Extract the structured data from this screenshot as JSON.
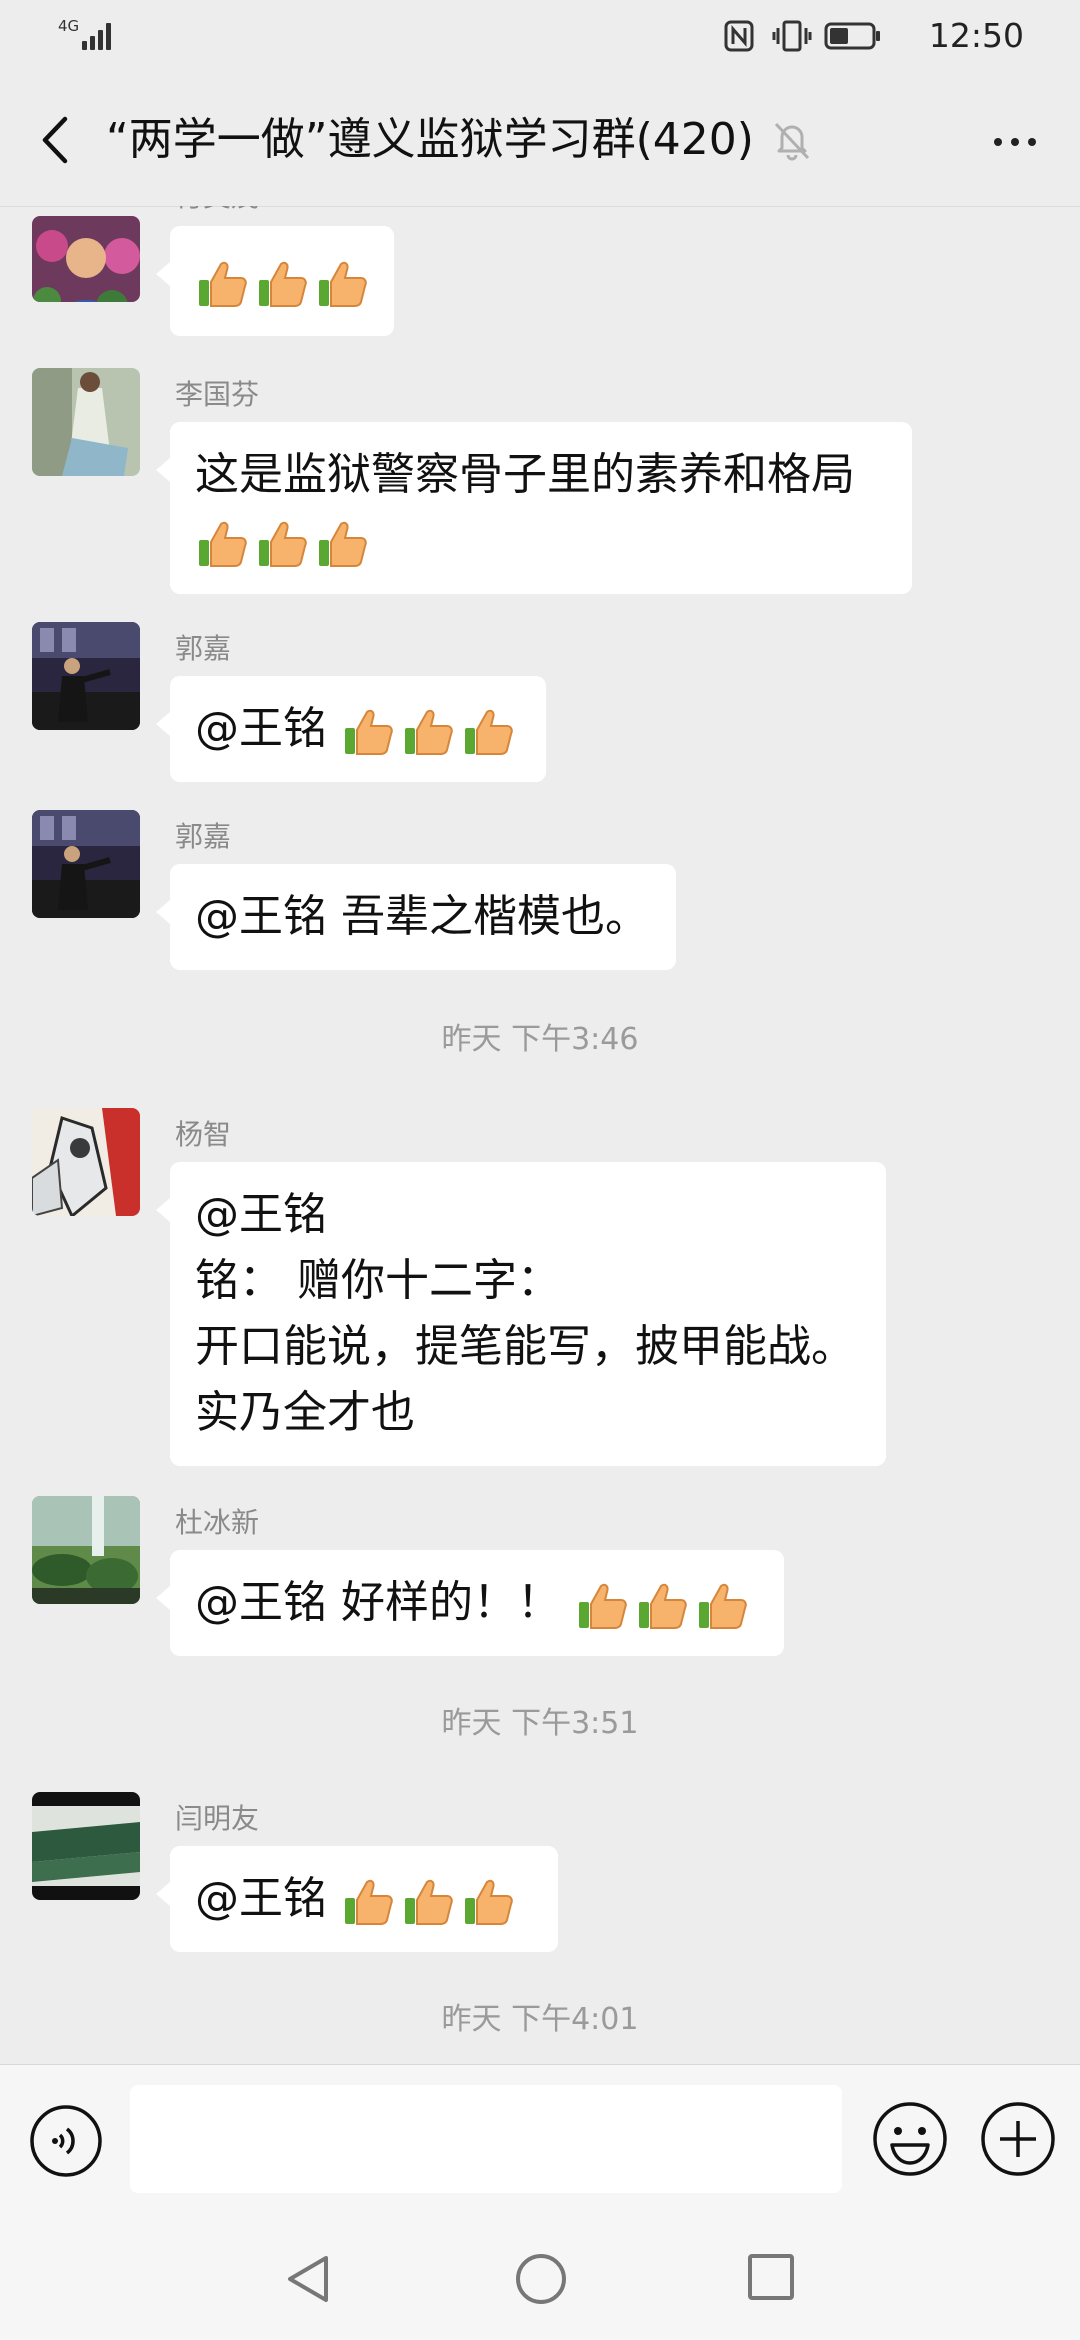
{
  "status_bar": {
    "network": "4G",
    "time": "12:50"
  },
  "header": {
    "title": "“两学一做”遵义监狱学习群(420)"
  },
  "messages": [
    {
      "sender": "付美茂",
      "lines": [
        ""
      ],
      "thumbs": 3
    },
    {
      "sender": "李国芬",
      "lines": [
        "这是监狱警察骨子里的素养和格局"
      ],
      "thumbs": 3
    },
    {
      "sender": "郭嘉",
      "lines": [
        "@王铭 "
      ],
      "thumbs": 3
    },
    {
      "sender": "郭嘉",
      "lines": [
        "@王铭  吾辈之楷模也。"
      ],
      "thumbs": 0
    },
    {
      "sender": "杨智",
      "lines": [
        "@王铭",
        "铭：  赠你十二字：",
        "开口能说，提笔能写，披甲能战。",
        "实乃全才也"
      ],
      "thumbs": 0
    },
    {
      "sender": "杜冰新",
      "lines": [
        "@王铭  好样的！！"
      ],
      "thumbs": 3
    },
    {
      "sender": "闫明友",
      "lines": [
        "@王铭 "
      ],
      "thumbs": 3
    }
  ],
  "timestamps": [
    "昨天 下午3:46",
    "昨天 下午3:51",
    "昨天 下午4:01"
  ],
  "input": {
    "value": "",
    "placeholder": ""
  },
  "icons": {
    "back": "back-chevron-icon",
    "mute": "bell-off-icon",
    "more": "more-dots-icon",
    "voice": "voice-icon",
    "emoji": "emoji-icon",
    "plus": "plus-icon",
    "thumb": "thumbs-up-emoji-icon"
  },
  "colors": {
    "background": "#ededed",
    "bubble": "#ffffff",
    "sender_text": "#8a8a8a",
    "timestamp_text": "#9a9a9a"
  }
}
